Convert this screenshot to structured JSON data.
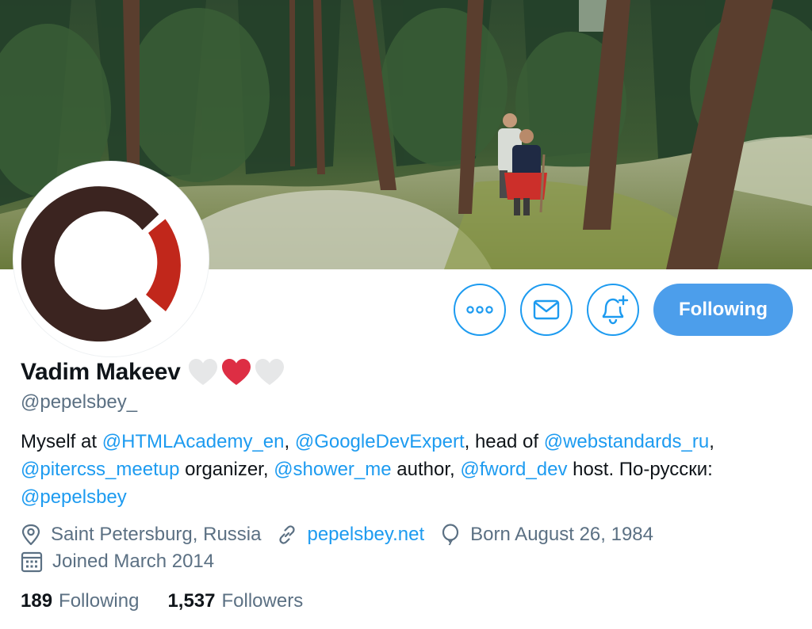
{
  "banner": {
    "description_icon": "forest-banner-photo"
  },
  "avatar": {
    "icon": "logo-avatar",
    "colors": {
      "dark": "#3b2420",
      "red": "#c1271b"
    }
  },
  "actions": {
    "more_icon": "more-horizontal-icon",
    "message_icon": "mail-icon",
    "notify_icon": "bell-plus-icon",
    "follow_label": "Following"
  },
  "profile": {
    "name": "Vadim Makeev",
    "handle": "@pepelsbey_",
    "hearts": [
      "white-heart-icon",
      "red-heart-icon",
      "white-heart-icon"
    ]
  },
  "bio": {
    "t1": "Myself at ",
    "m1": "@HTMLAcademy_en",
    "t2": ", ",
    "m2": "@GoogleDevExpert",
    "t3": ", head of ",
    "m3": "@webstandards_ru",
    "t4": ",",
    "m4": "@pitercss_meetup",
    "t5": " organizer, ",
    "m5": "@shower_me",
    "t6": " author, ",
    "m6": "@fword_dev",
    "t7": " host. По-русски:",
    "m7": "@pepelsbey"
  },
  "meta": {
    "location": "Saint Petersburg, Russia",
    "website": "pepelsbey.net",
    "birthday": "Born August 26, 1984",
    "joined": "Joined March 2014"
  },
  "stats": {
    "following_count": "189",
    "following_label": "Following",
    "followers_count": "1,537",
    "followers_label": "Followers"
  },
  "colors": {
    "accent": "#1d9bf0",
    "follow_button": "#4c9eeb",
    "secondary_text": "#5b7083"
  }
}
